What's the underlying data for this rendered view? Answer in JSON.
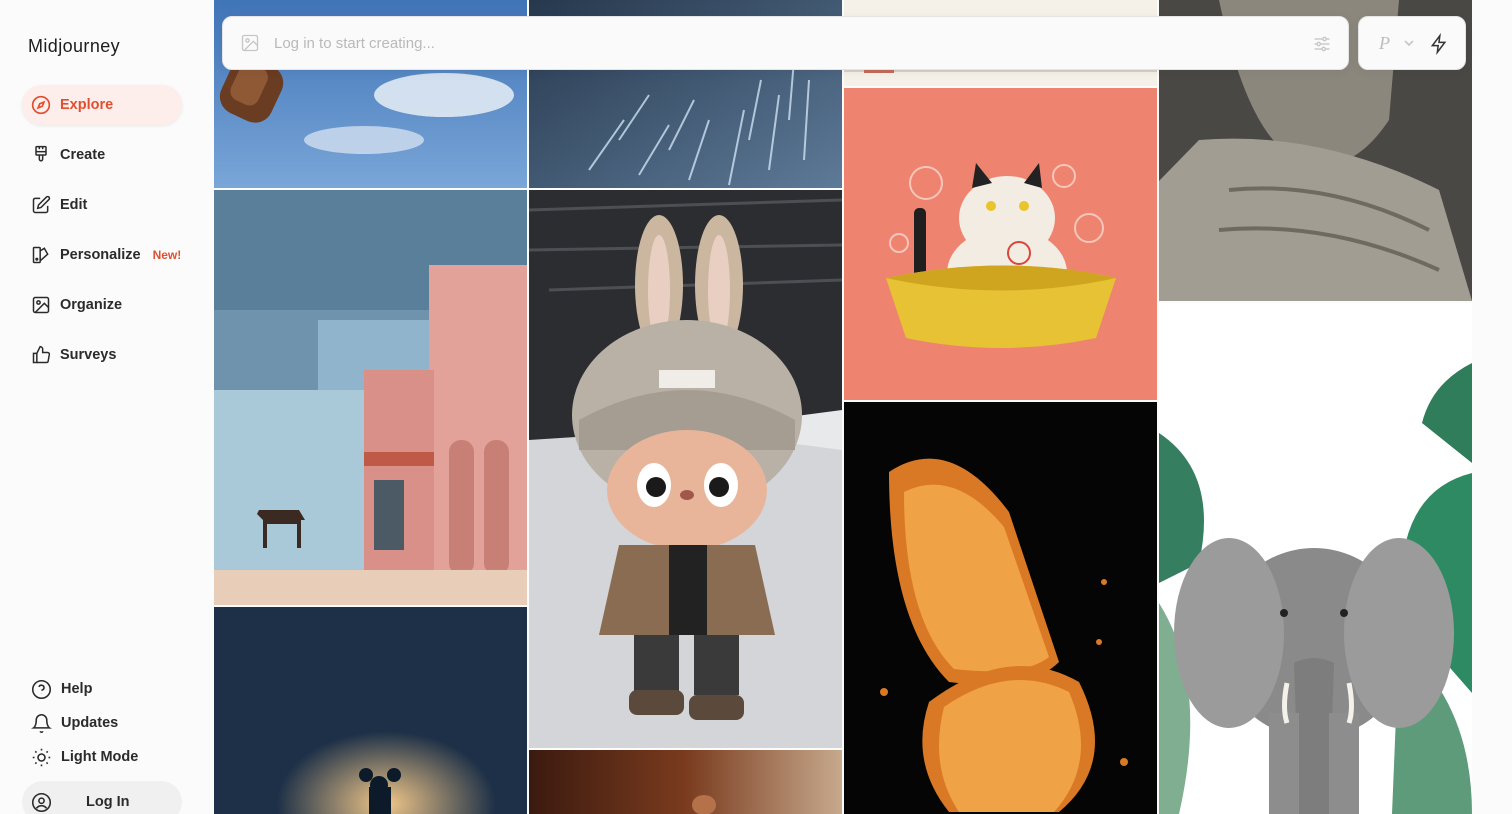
{
  "app": {
    "name": "Midjourney"
  },
  "sidebar": {
    "items": [
      {
        "label": "Explore",
        "icon": "compass-icon",
        "active": true
      },
      {
        "label": "Create",
        "icon": "brush-icon"
      },
      {
        "label": "Edit",
        "icon": "edit-icon"
      },
      {
        "label": "Personalize",
        "icon": "personalize-icon",
        "badge": "New!"
      },
      {
        "label": "Organize",
        "icon": "image-icon"
      },
      {
        "label": "Surveys",
        "icon": "thumbs-up-icon"
      }
    ],
    "bottom": [
      {
        "label": "Help",
        "icon": "help-icon"
      },
      {
        "label": "Updates",
        "icon": "bell-icon"
      },
      {
        "label": "Light Mode",
        "icon": "sun-icon"
      }
    ],
    "login_label": "Log In"
  },
  "prompt": {
    "placeholder": "Log in to start creating..."
  },
  "mode": {
    "letter": "P"
  },
  "colors": {
    "accent": "#e0502f",
    "accent_bg": "#fdeeec"
  },
  "gallery": {
    "tiles": [
      "sky-bottle",
      "light-streaks",
      "cat-bath",
      "stone-bust",
      "pink-buildings-horse",
      "kenzo-bunny",
      "fried-chicken",
      "elephant-jungle",
      "mouse-spotlight",
      "warm-food"
    ]
  }
}
